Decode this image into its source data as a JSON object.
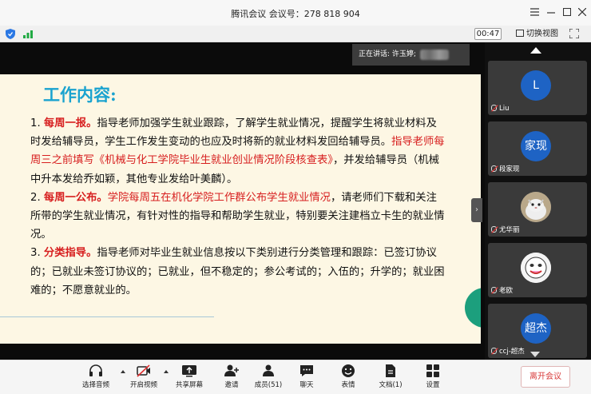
{
  "window": {
    "title": "腾讯会议  会议号：278 818 904"
  },
  "infobar": {
    "timer": "00:47",
    "switch_view": "切换视图"
  },
  "stage": {
    "speaking_label": "正在讲话: 许玉婷;"
  },
  "slide": {
    "title": "工作内容:",
    "p1_num": "1. ",
    "p1_head": "每周一报。",
    "p1_text_a": "指导老师加强学生就业跟踪，了解学生就业情况，提醒学生将就业材料及时发给辅导员，学生工作发生变动的也应及时将新的就业材料发回给辅导员。",
    "p1_red": "指导老师每周三之前填写《机械与化工学院毕业生就业创业情况阶段核查表》",
    "p1_text_b": "，并发给辅导员（机械中升本发给乔如颖，其他专业发给叶美麟）。",
    "p2_num": "2. ",
    "p2_head": "每周一公布。",
    "p2_red": "学院每周五在机化学院工作群公布学生就业情况",
    "p2_text": "，请老师们下载和关注所带的学生就业情况，有针对性的指导和帮助学生就业，特别要关注建档立卡生的就业情况。",
    "p3_num": "3. ",
    "p3_head": "分类指导。",
    "p3_text": "指导老师对毕业生就业信息按以下类别进行分类管理和跟踪：已签订协议的；已就业未签订协议的；已就业，但不稳定的；参公考试的；入伍的；升学的；就业困难的；不愿意就业的。"
  },
  "participants": [
    {
      "avatar_text": "L",
      "name": "Liu",
      "color": "#1e63c4"
    },
    {
      "avatar_text": "家现",
      "name": "段家现",
      "color": "#1e63c4"
    },
    {
      "avatar_text": "",
      "name": "尤华丽",
      "color": "#8d8d8d"
    },
    {
      "avatar_text": "",
      "name": "老欧",
      "color": "#f4f4f4"
    },
    {
      "avatar_text": "超杰",
      "name": "ccj-超杰",
      "color": "#1e63c4"
    }
  ],
  "toolbar": {
    "audio": "选择音频",
    "video": "开启视频",
    "share": "共享屏幕",
    "invite": "邀请",
    "members": "成员(51)",
    "chat": "聊天",
    "emoji": "表情",
    "docs": "文档(1)",
    "settings": "设置",
    "leave": "离开会议"
  }
}
